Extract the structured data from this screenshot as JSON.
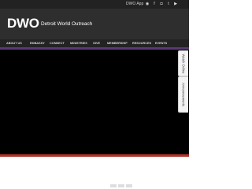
{
  "topbar": {
    "app_link": "DWO App",
    "socials": [
      "rss-icon",
      "facebook-icon",
      "instagram-icon",
      "twitter-icon",
      "youtube-icon"
    ]
  },
  "brand": {
    "logo": "DWO",
    "name": "Detroit World Outreach"
  },
  "nav": {
    "items": [
      "ABOUT US",
      "EMBASSY",
      "CONNECT",
      "MINISTRIES",
      "GIVE",
      "MEMBERSHIP",
      "RESOURCES",
      "EVENTS"
    ]
  },
  "side_tabs": {
    "watch_online": "Watch Online",
    "announcements": "Announcements"
  },
  "colors": {
    "header": "#2e2e2e",
    "accent_purple": "#5a3a74",
    "accent_red": "#c7352b",
    "player": "#000000"
  }
}
